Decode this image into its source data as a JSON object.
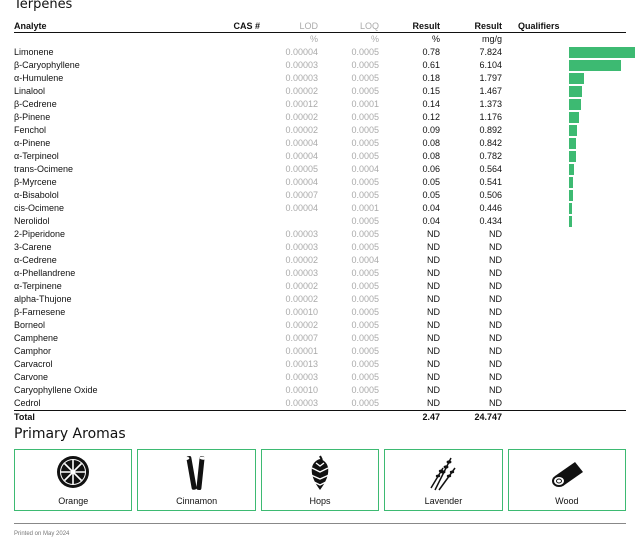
{
  "terpenes": {
    "title": "Terpenes",
    "headers": {
      "analyte": "Analyte",
      "cas": "CAS #",
      "lod": "LOD",
      "loq": "LOQ",
      "result1": "Result",
      "result2": "Result",
      "qualifiers": "Qualifiers"
    },
    "units": {
      "lod": "%",
      "loq": "%",
      "result1": "%",
      "result2": "mg/g"
    },
    "bar_color": "#3dba72",
    "rows": [
      {
        "name": "Limonene",
        "lod": "0.00004",
        "loq": "0.0005",
        "pct": "0.78",
        "mgg": "7.824",
        "level": 0.78
      },
      {
        "name": "β-Caryophyllene",
        "lod": "0.00003",
        "loq": "0.0005",
        "pct": "0.61",
        "mgg": "6.104",
        "level": 0.61
      },
      {
        "name": "α-Humulene",
        "lod": "0.00003",
        "loq": "0.0005",
        "pct": "0.18",
        "mgg": "1.797",
        "level": 0.18
      },
      {
        "name": "Linalool",
        "lod": "0.00002",
        "loq": "0.0005",
        "pct": "0.15",
        "mgg": "1.467",
        "level": 0.15
      },
      {
        "name": "β-Cedrene",
        "lod": "0.00012",
        "loq": "0.0001",
        "pct": "0.14",
        "mgg": "1.373",
        "level": 0.14
      },
      {
        "name": "β-Pinene",
        "lod": "0.00002",
        "loq": "0.0005",
        "pct": "0.12",
        "mgg": "1.176",
        "level": 0.12
      },
      {
        "name": "Fenchol",
        "lod": "0.00002",
        "loq": "0.0005",
        "pct": "0.09",
        "mgg": "0.892",
        "level": 0.09
      },
      {
        "name": "α-Pinene",
        "lod": "0.00004",
        "loq": "0.0005",
        "pct": "0.08",
        "mgg": "0.842",
        "level": 0.08
      },
      {
        "name": "α-Terpineol",
        "lod": "0.00004",
        "loq": "0.0005",
        "pct": "0.08",
        "mgg": "0.782",
        "level": 0.08
      },
      {
        "name": "trans-Ocimene",
        "lod": "0.00005",
        "loq": "0.0004",
        "pct": "0.06",
        "mgg": "0.564",
        "level": 0.06
      },
      {
        "name": "β-Myrcene",
        "lod": "0.00004",
        "loq": "0.0005",
        "pct": "0.05",
        "mgg": "0.541",
        "level": 0.05
      },
      {
        "name": "α-Bisabolol",
        "lod": "0.00007",
        "loq": "0.0005",
        "pct": "0.05",
        "mgg": "0.506",
        "level": 0.05
      },
      {
        "name": "cis-Ocimene",
        "lod": "0.00004",
        "loq": "0.0001",
        "pct": "0.04",
        "mgg": "0.446",
        "level": 0.04
      },
      {
        "name": "Nerolidol",
        "lod": "",
        "loq": "0.0005",
        "pct": "0.04",
        "mgg": "0.434",
        "level": 0.04
      },
      {
        "name": "2-Piperidone",
        "lod": "0.00003",
        "loq": "0.0005",
        "pct": "ND",
        "mgg": "ND",
        "level": 0
      },
      {
        "name": "3-Carene",
        "lod": "0.00003",
        "loq": "0.0005",
        "pct": "ND",
        "mgg": "ND",
        "level": 0
      },
      {
        "name": "α-Cedrene",
        "lod": "0.00002",
        "loq": "0.0004",
        "pct": "ND",
        "mgg": "ND",
        "level": 0
      },
      {
        "name": "α-Phellandrene",
        "lod": "0.00003",
        "loq": "0.0005",
        "pct": "ND",
        "mgg": "ND",
        "level": 0
      },
      {
        "name": "α-Terpinene",
        "lod": "0.00002",
        "loq": "0.0005",
        "pct": "ND",
        "mgg": "ND",
        "level": 0
      },
      {
        "name": "alpha-Thujone",
        "lod": "0.00002",
        "loq": "0.0005",
        "pct": "ND",
        "mgg": "ND",
        "level": 0
      },
      {
        "name": "β-Farnesene",
        "lod": "0.00010",
        "loq": "0.0005",
        "pct": "ND",
        "mgg": "ND",
        "level": 0
      },
      {
        "name": "Borneol",
        "lod": "0.00002",
        "loq": "0.0005",
        "pct": "ND",
        "mgg": "ND",
        "level": 0
      },
      {
        "name": "Camphene",
        "lod": "0.00007",
        "loq": "0.0005",
        "pct": "ND",
        "mgg": "ND",
        "level": 0
      },
      {
        "name": "Camphor",
        "lod": "0.00001",
        "loq": "0.0005",
        "pct": "ND",
        "mgg": "ND",
        "level": 0
      },
      {
        "name": "Carvacrol",
        "lod": "0.00013",
        "loq": "0.0005",
        "pct": "ND",
        "mgg": "ND",
        "level": 0
      },
      {
        "name": "Carvone",
        "lod": "0.00003",
        "loq": "0.0005",
        "pct": "ND",
        "mgg": "ND",
        "level": 0
      },
      {
        "name": "Caryophyllene Oxide",
        "lod": "0.00010",
        "loq": "0.0005",
        "pct": "ND",
        "mgg": "ND",
        "level": 0
      },
      {
        "name": "Cedrol",
        "lod": "0.00003",
        "loq": "0.0005",
        "pct": "ND",
        "mgg": "ND",
        "level": 0
      }
    ],
    "total": {
      "label": "Total",
      "pct": "2.47",
      "mgg": "24.747"
    }
  },
  "aromas": {
    "title": "Primary Aromas",
    "border_color": "#3dba72",
    "items": [
      {
        "label": "Orange",
        "icon": "orange-slice-icon"
      },
      {
        "label": "Cinnamon",
        "icon": "cinnamon-sticks-icon"
      },
      {
        "label": "Hops",
        "icon": "hops-icon"
      },
      {
        "label": "Lavender",
        "icon": "lavender-icon"
      },
      {
        "label": "Wood",
        "icon": "wood-log-icon"
      }
    ]
  },
  "footer": {
    "text": "Printed on May 2024"
  }
}
